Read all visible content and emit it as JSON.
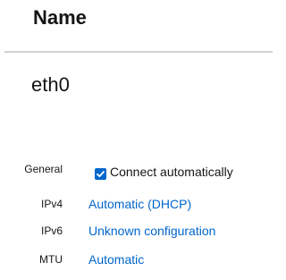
{
  "header": {
    "title": "Name"
  },
  "connection": {
    "name": "eth0"
  },
  "details": {
    "general": {
      "label": "General",
      "checkbox_label": "Connect automatically",
      "checked": true
    },
    "ipv4": {
      "label": "IPv4",
      "value": "Automatic (DHCP)"
    },
    "ipv6": {
      "label": "IPv6",
      "value": "Unknown configuration"
    },
    "mtu": {
      "label": "MTU",
      "value": "Automatic"
    }
  },
  "colors": {
    "link": "#0066cc",
    "checkbox": "#0066cc",
    "divider": "#d2d2d2",
    "text": "#151515"
  },
  "icons": {
    "checkbox": "check-icon"
  }
}
